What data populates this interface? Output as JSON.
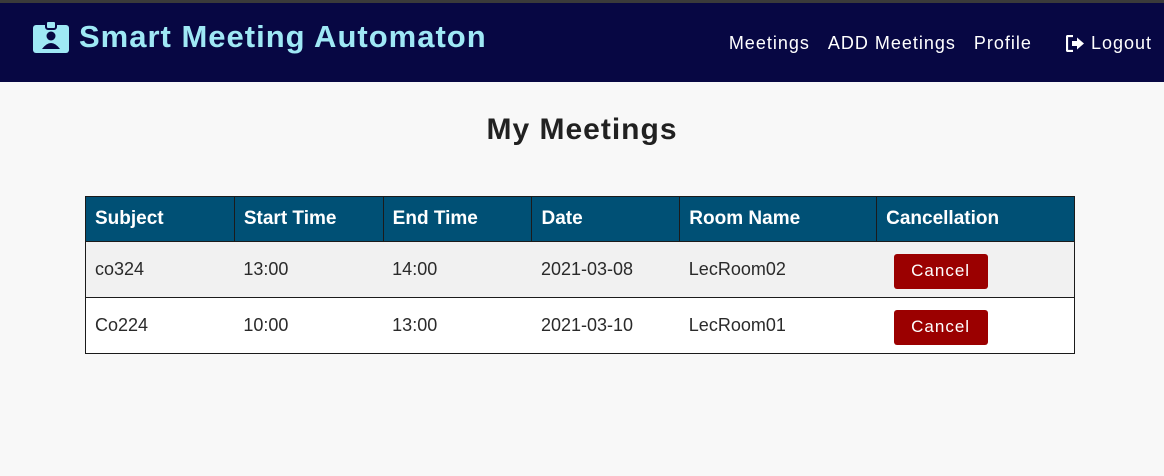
{
  "header": {
    "title": "Smart Meeting Automaton",
    "brand_icon": "id-badge-icon",
    "title_color": "#9fe8f5",
    "background": "#070743",
    "nav": [
      {
        "label": "Meetings"
      },
      {
        "label": "ADD Meetings"
      },
      {
        "label": "Profile"
      }
    ],
    "logout": {
      "label": "Logout",
      "icon": "sign-out-icon"
    }
  },
  "main": {
    "title": "My Meetings",
    "table": {
      "columns": [
        "Subject",
        "Start Time",
        "End Time",
        "Date",
        "Room Name",
        "Cancellation"
      ],
      "header_color": "#005075",
      "rows": [
        {
          "subject": "co324",
          "start_time": "13:00",
          "end_time": "14:00",
          "date": "2021-03-08",
          "room_name": "LecRoom02",
          "action_label": "Cancel"
        },
        {
          "subject": "Co224",
          "start_time": "10:00",
          "end_time": "13:00",
          "date": "2021-03-10",
          "room_name": "LecRoom01",
          "action_label": "Cancel"
        }
      ]
    },
    "cancel_button_color": "#9b0000"
  }
}
